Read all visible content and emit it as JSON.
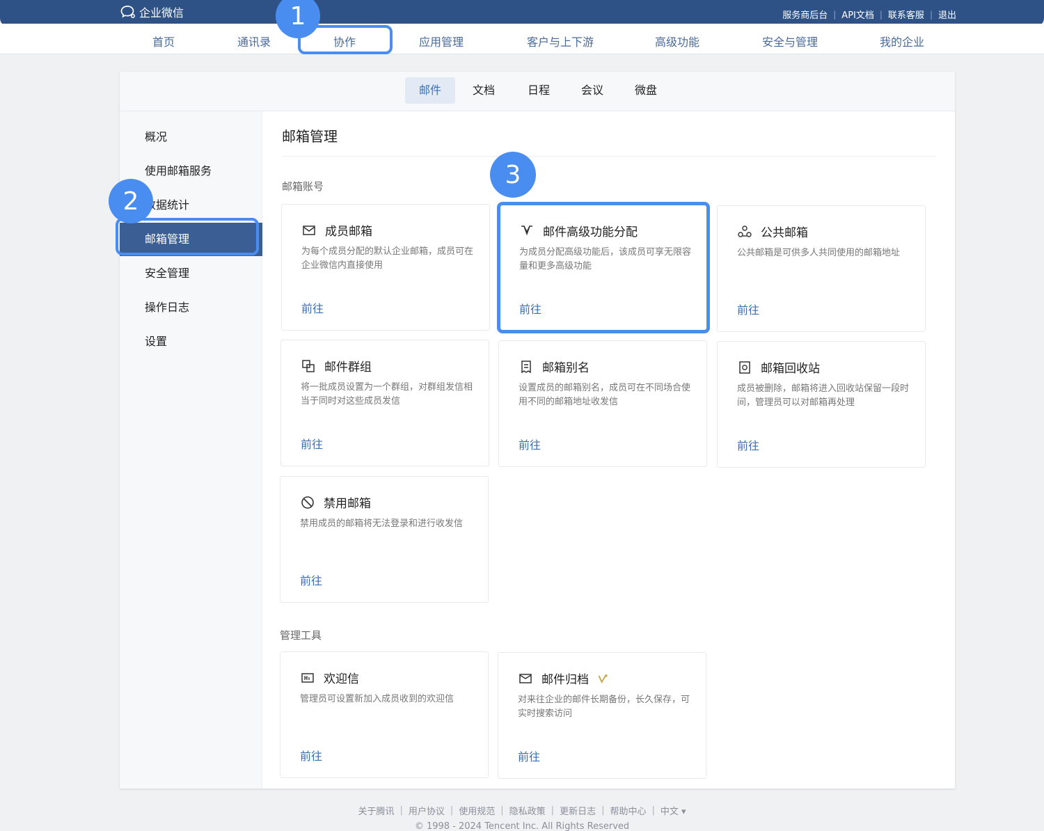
{
  "app": {
    "logo_text": "企业微信"
  },
  "top_links": [
    "服务商后台",
    "API文档",
    "联系客服",
    "退出"
  ],
  "main_nav": [
    "首页",
    "通讯录",
    "协作",
    "应用管理",
    "客户与上下游",
    "高级功能",
    "安全与管理",
    "我的企业"
  ],
  "main_nav_active": "协作",
  "sub_nav": [
    "邮件",
    "文档",
    "日程",
    "会议",
    "微盘"
  ],
  "sub_nav_active": "邮件",
  "sidebar": [
    "概况",
    "使用邮箱服务",
    "数据统计",
    "邮箱管理",
    "安全管理",
    "操作日志",
    "设置"
  ],
  "sidebar_active": "邮箱管理",
  "steps": [
    "1",
    "2",
    "3"
  ],
  "page_title": "邮箱管理",
  "section_accounts": "邮箱账号",
  "section_tools": "管理工具",
  "cards": [
    {
      "title": "成员邮箱",
      "desc": "为每个成员分配的默认企业邮箱，成员可在企业微信内直接使用",
      "link": "前往",
      "icon": "envelope-icon"
    },
    {
      "title": "邮件高级功能分配",
      "desc": "为成员分配高级功能后，该成员可享无限容量和更多高级功能",
      "link": "前往",
      "icon": "v-badge-icon"
    },
    {
      "title": "公共邮箱",
      "desc": "公共邮箱是可供多人共同使用的邮箱地址",
      "link": "前往",
      "icon": "group-icon"
    },
    {
      "title": "邮件群组",
      "desc": "将一批成员设置为一个群组，对群组发信相当于同时对这些成员发信",
      "link": "前往",
      "icon": "group-copy-icon"
    },
    {
      "title": "邮箱别名",
      "desc": "设置成员的邮箱别名，成员可在不同场合使用不同的邮箱地址收发信",
      "link": "前往",
      "icon": "document-icon"
    },
    {
      "title": "邮箱回收站",
      "desc": "成员被删除，邮箱将进入回收站保留一段时间，管理员可以对邮箱再处理",
      "link": "前往",
      "icon": "recycle-icon"
    },
    {
      "title": "禁用邮箱",
      "desc": "禁用成员的邮箱将无法登录和进行收发信",
      "link": "前往",
      "icon": "ban-icon"
    }
  ],
  "tools": [
    {
      "title": "欢迎信",
      "desc": "管理员可设置新加入成员收到的欢迎信",
      "link": "前往",
      "icon": "hi-icon"
    },
    {
      "title": "邮件归档",
      "desc": "对来往企业的邮件长期备份，长久保存，可实时搜索访问",
      "link": "前往",
      "icon": "archive-icon"
    }
  ],
  "footer_links": [
    "关于腾讯",
    "用户协议",
    "使用规范",
    "隐私政策",
    "更新日志",
    "帮助中心",
    "中文 ▾"
  ],
  "footer_copyright": "© 1998 - 2024 Tencent Inc. All Rights Reserved",
  "colors": {
    "brand": "#2e5285",
    "highlight": "#4a8df0",
    "link": "#3a6eb5",
    "active_sidebar": "#3b5f94"
  }
}
